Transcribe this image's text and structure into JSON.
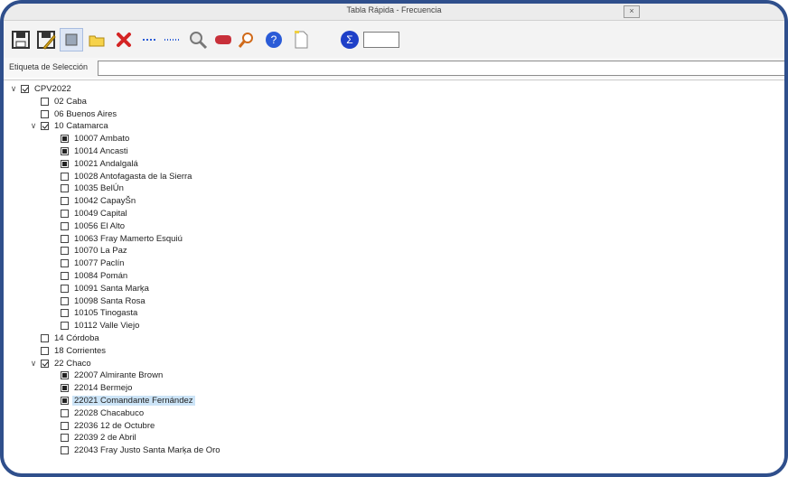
{
  "window": {
    "title": "Tabla Rápida - Frecuencia",
    "close_glyph": "×"
  },
  "toolbar": {
    "icons": [
      "save-icon",
      "save-as-icon",
      "grid-icon",
      "folder-icon",
      "delete-icon",
      "dash-icon",
      "dots-icon",
      "magnifier-icon",
      "hand-icon",
      "find-icon",
      "help-icon",
      "new-document-icon",
      "sigma-icon"
    ],
    "value": ""
  },
  "selection": {
    "label": "Etiqueta de Selección",
    "value": ""
  },
  "tree": [
    {
      "indent": 0,
      "arrow": "∨",
      "state": "checked",
      "label": "CPV2022"
    },
    {
      "indent": 1,
      "arrow": "",
      "state": "unchecked",
      "label": "02 Caba"
    },
    {
      "indent": 1,
      "arrow": "",
      "state": "unchecked",
      "label": "06 Buenos Aires"
    },
    {
      "indent": 1,
      "arrow": "∨",
      "state": "checked",
      "label": "10 Catamarca"
    },
    {
      "indent": 2,
      "arrow": "",
      "state": "partial",
      "label": "10007 Ambato"
    },
    {
      "indent": 2,
      "arrow": "",
      "state": "partial",
      "label": "10014 Ancasti"
    },
    {
      "indent": 2,
      "arrow": "",
      "state": "partial",
      "label": "10021 Andalgalá"
    },
    {
      "indent": 2,
      "arrow": "",
      "state": "unchecked",
      "label": "10028 Antofagasta de la Sierra"
    },
    {
      "indent": 2,
      "arrow": "",
      "state": "unchecked",
      "label": "10035 BelÚn"
    },
    {
      "indent": 2,
      "arrow": "",
      "state": "unchecked",
      "label": "10042 CapayŠn"
    },
    {
      "indent": 2,
      "arrow": "",
      "state": "unchecked",
      "label": "10049 Capital"
    },
    {
      "indent": 2,
      "arrow": "",
      "state": "unchecked",
      "label": "10056 El Alto"
    },
    {
      "indent": 2,
      "arrow": "",
      "state": "unchecked",
      "label": "10063 Fray Mamerto Esquiú"
    },
    {
      "indent": 2,
      "arrow": "",
      "state": "unchecked",
      "label": "10070 La Paz"
    },
    {
      "indent": 2,
      "arrow": "",
      "state": "unchecked",
      "label": "10077 Paclín"
    },
    {
      "indent": 2,
      "arrow": "",
      "state": "unchecked",
      "label": "10084 Pomán"
    },
    {
      "indent": 2,
      "arrow": "",
      "state": "unchecked",
      "label": "10091 Santa Marķa"
    },
    {
      "indent": 2,
      "arrow": "",
      "state": "unchecked",
      "label": "10098 Santa Rosa"
    },
    {
      "indent": 2,
      "arrow": "",
      "state": "unchecked",
      "label": "10105 Tinogasta"
    },
    {
      "indent": 2,
      "arrow": "",
      "state": "unchecked",
      "label": "10112 Valle Viejo"
    },
    {
      "indent": 1,
      "arrow": "",
      "state": "unchecked",
      "label": "14 Córdoba"
    },
    {
      "indent": 1,
      "arrow": "",
      "state": "unchecked",
      "label": "18 Corrientes"
    },
    {
      "indent": 1,
      "arrow": "∨",
      "state": "checked",
      "label": "22 Chaco"
    },
    {
      "indent": 2,
      "arrow": "",
      "state": "partial",
      "label": "22007 Almirante Brown"
    },
    {
      "indent": 2,
      "arrow": "",
      "state": "partial",
      "label": "22014 Bermejo"
    },
    {
      "indent": 2,
      "arrow": "",
      "state": "partial",
      "label": "22021 Comandante Fernández",
      "selected": true
    },
    {
      "indent": 2,
      "arrow": "",
      "state": "unchecked",
      "label": "22028 Chacabuco"
    },
    {
      "indent": 2,
      "arrow": "",
      "state": "unchecked",
      "label": "22036 12 de Octubre"
    },
    {
      "indent": 2,
      "arrow": "",
      "state": "unchecked",
      "label": "22039 2 de Abril"
    },
    {
      "indent": 2,
      "arrow": "",
      "state": "unchecked",
      "label": "22043 Fray Justo Santa Marķa de Oro"
    }
  ],
  "colors": {
    "frame": "#2f4f8c",
    "selection": "#cce4f7",
    "delete": "#d42424",
    "help": "#2a5bd7",
    "sigma": "#1e40c8"
  }
}
